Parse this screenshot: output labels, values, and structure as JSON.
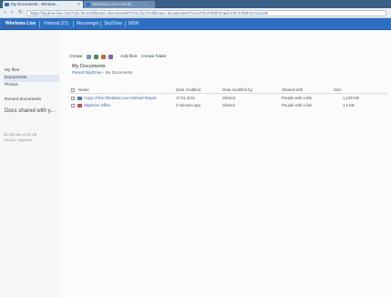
{
  "browser": {
    "tabs": [
      {
        "label": "My Documents - Window..."
      },
      {
        "label": "Windows Live Hotmail"
      }
    ],
    "url": "https://skydrive.live.com/?cid=f2c47e8f2c&sc=documents#!/?cid=f2c47e8f2c&sc=documents#!/?cid=F2C47E8F2C&id=F2C47E8F2C%21106"
  },
  "wl_header": {
    "brand": "Windows Live",
    "links": [
      "Hotmail (21)",
      "Messenger",
      "SkyDrive",
      "MSN"
    ]
  },
  "sidebar": {
    "title": "SkyDrive",
    "items": [
      "My files",
      "Documents",
      "Photos",
      "Recent documents",
      "Docs shared with y..."
    ],
    "storage": "25 GB free of 25 GB\nGet ALL SkyDrive"
  },
  "toolbar": {
    "items": [
      "Create",
      "Add files",
      "Create folder"
    ]
  },
  "folder": {
    "title": "My Documents",
    "breadcrumb_parent": "Parent SkyDrive",
    "breadcrumb_sep": "›",
    "breadcrumb_current": "My Documents"
  },
  "table": {
    "headers": [
      "Name",
      "Date modified",
      "Date modified by",
      "Shared with",
      "Size"
    ],
    "rows": [
      {
        "name": "Copy of the Windows Live Hotmail Report",
        "date": "17:01.2011",
        "by": "Shared",
        "shared": "People with a link",
        "size": "1,139 KB"
      },
      {
        "name": "SkyDrive Office",
        "date": "3 minutes ago",
        "by": "Shared",
        "shared": "People with a link",
        "size": "1.1 KB"
      }
    ]
  },
  "colors": {
    "chrome_tabstrip": "#3b5f86",
    "wl_bar": "#2d6fc2",
    "link": "#3a66a8",
    "sidebar_selected": "#dfe7f2"
  }
}
